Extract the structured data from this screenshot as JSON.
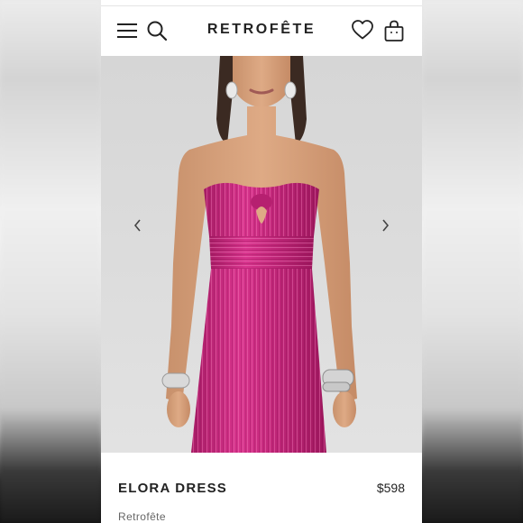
{
  "header": {
    "logo": "RETROFÊTE",
    "icons": [
      "menu-icon",
      "search-icon",
      "heart-icon",
      "bag-icon"
    ]
  },
  "carousel": {
    "prev_icon": "chevron-left-icon",
    "next_icon": "chevron-right-icon"
  },
  "product": {
    "name": "ELORA DRESS",
    "price": "$598",
    "brand": "Retrofête",
    "color": "#c2277a"
  }
}
